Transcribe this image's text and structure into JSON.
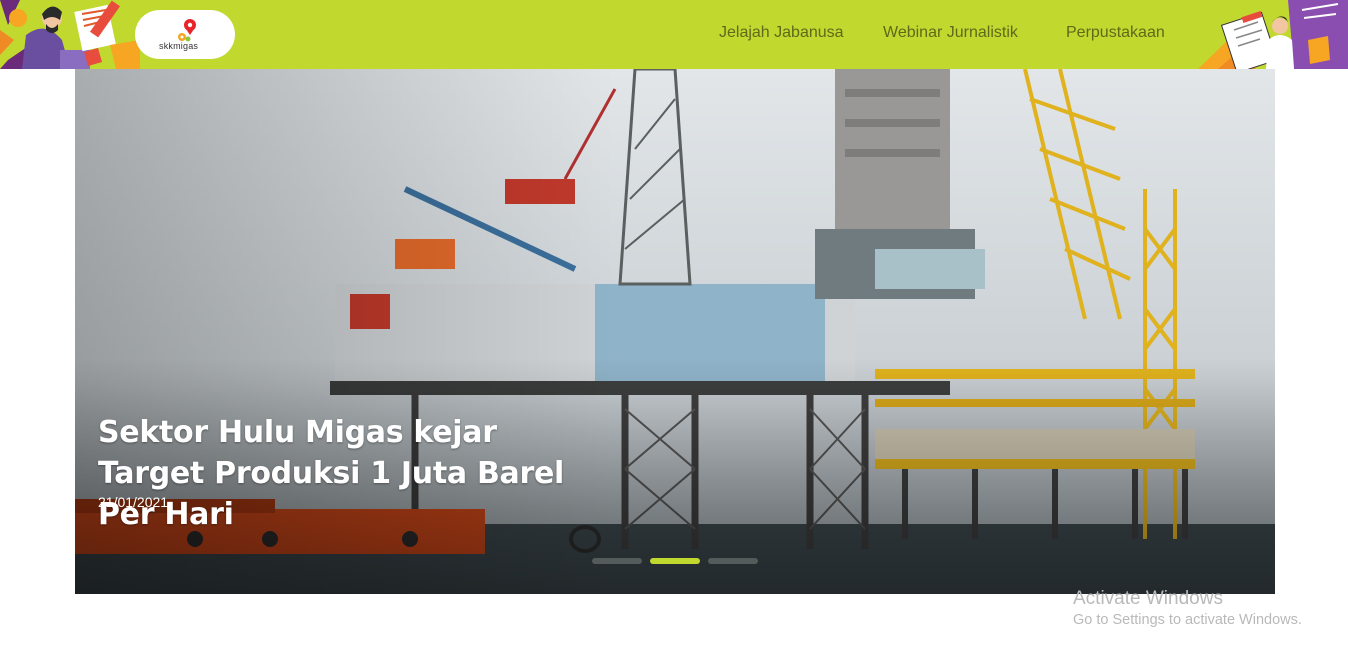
{
  "header": {
    "logo_text": "skkmigas",
    "nav": [
      {
        "label": "Jelajah Jabanusa"
      },
      {
        "label": "Webinar Jurnalistik"
      },
      {
        "label": "Perpustakaan"
      }
    ],
    "bg_color": "#c1d82f"
  },
  "hero": {
    "headline": "Sektor Hulu Migas kejar Target Produksi 1 Juta Barel Per Hari",
    "date": "21/01/2021",
    "slides": 3,
    "active_slide": 2
  },
  "watermark": {
    "title": "Activate Windows",
    "subtitle": "Go to Settings to activate Windows."
  }
}
